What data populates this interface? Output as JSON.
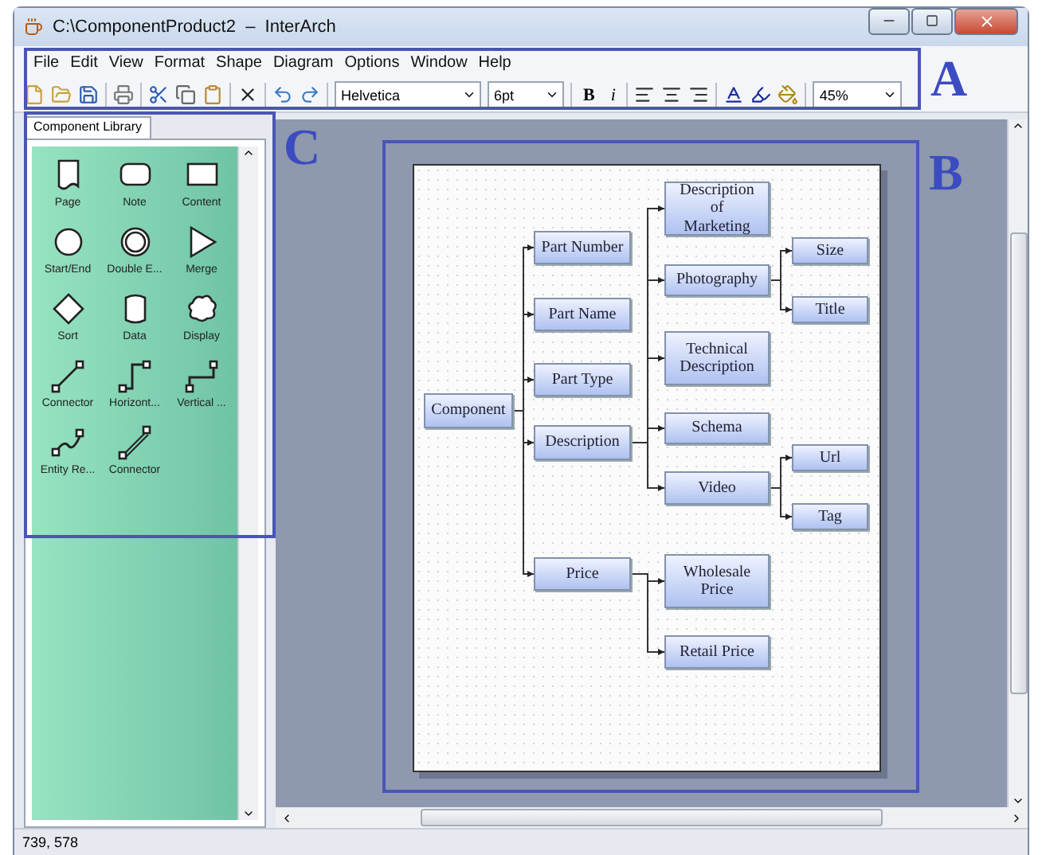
{
  "window": {
    "title": "C:\\ComponentProduct2  –  InterArch"
  },
  "menu": [
    "File",
    "Edit",
    "View",
    "Format",
    "Shape",
    "Diagram",
    "Options",
    "Window",
    "Help"
  ],
  "toolbar": {
    "font": "Helvetica",
    "size": "6pt",
    "bold": "B",
    "italic": "i",
    "zoom": "45%"
  },
  "library": {
    "tab": {
      "label": "Component Library",
      "selected": true
    },
    "items": [
      "Page",
      "Note",
      "Content",
      "Start/End",
      "Double E...",
      "Merge",
      "Sort",
      "Data",
      "Display",
      "Connector",
      "Horizont...",
      "Vertical ...",
      "Entity Re...",
      "Connector"
    ]
  },
  "diagram": {
    "label": "Component",
    "children": [
      {
        "label": "Part Number"
      },
      {
        "label": "Part Name"
      },
      {
        "label": "Part Type"
      },
      {
        "label": "Description",
        "children": [
          {
            "label": "Description of Marketing"
          },
          {
            "label": "Photography",
            "children": [
              {
                "label": "Size"
              },
              {
                "label": "Title"
              }
            ]
          },
          {
            "label": "Technical Description"
          },
          {
            "label": "Schema"
          },
          {
            "label": "Video",
            "children": [
              {
                "label": "Url"
              },
              {
                "label": "Tag"
              }
            ]
          }
        ]
      },
      {
        "label": "Price",
        "children": [
          {
            "label": "Wholesale Price"
          },
          {
            "label": "Retail Price"
          }
        ]
      }
    ]
  },
  "annotations": [
    "A",
    "B",
    "C"
  ],
  "status_bar": "739, 578"
}
